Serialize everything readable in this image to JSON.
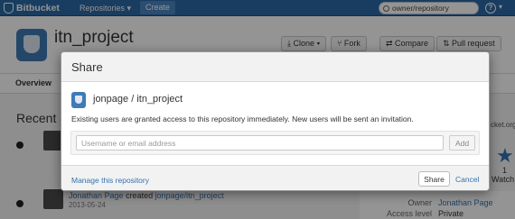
{
  "topbar": {
    "brand": "Bitbucket",
    "repositories_menu": "Repositories ▾",
    "create_button": "Create",
    "search_value": "owner/repository",
    "help_icon": "question-circle-icon"
  },
  "repo_header": {
    "title": "itn_project",
    "clone_button": "⤓ Clone ▾",
    "fork_button": "⑂ Fork",
    "compare_button": "⇄ Compare",
    "pull_request_button": "⇅ Pull request"
  },
  "tabs": {
    "overview": "Overview"
  },
  "feed": {
    "heading": "Recent a",
    "created_by": "Jonathan Page",
    "created_text": " created ",
    "created_repo": "jonpage/itn_project",
    "date": "2013-05-24"
  },
  "sidebar": {
    "clone_url_fragment": "cket.org/",
    "watch_count": "1",
    "watchers_label": "Watch",
    "owner_label": "Owner",
    "owner_value": "Jonathan Page",
    "access_label": "Access level",
    "access_value": "Private"
  },
  "share_modal": {
    "title": "Share",
    "repo_name": "jonpage / itn_project",
    "info_text": "Existing users are granted access to this repository immediately. New users will be sent an invitation.",
    "input_placeholder": "Username or email address",
    "add_button": "Add",
    "manage_link": "Manage this repository",
    "share_button": "Share",
    "cancel_link": "Cancel"
  }
}
